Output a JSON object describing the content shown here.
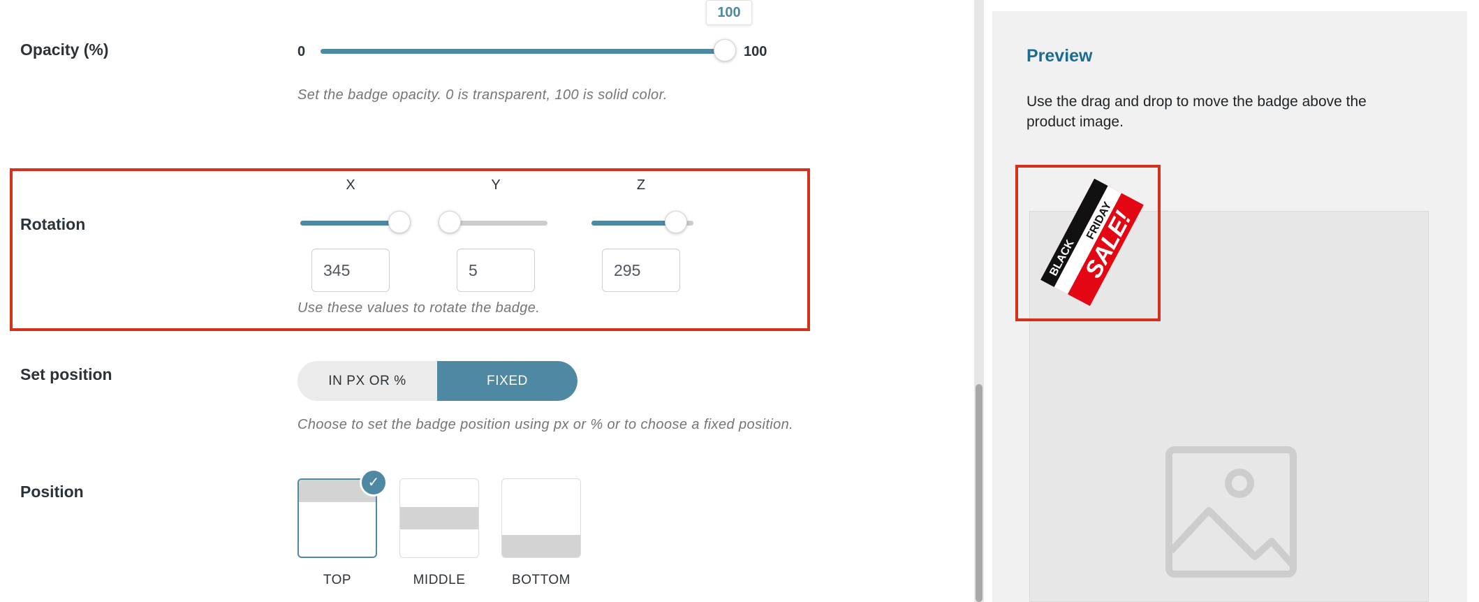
{
  "opacity": {
    "label": "Opacity (%)",
    "min_label": "0",
    "max_label": "100",
    "value": 100,
    "tooltip": "100",
    "description": "Set the badge opacity. 0 is transparent, 100 is solid color."
  },
  "rotation": {
    "label": "Rotation",
    "axes": [
      {
        "name": "X",
        "value": "345"
      },
      {
        "name": "Y",
        "value": "5"
      },
      {
        "name": "Z",
        "value": "295"
      }
    ],
    "description": "Use these values to rotate the badge."
  },
  "set_position": {
    "label": "Set position",
    "options": [
      "IN PX OR %",
      "FIXED"
    ],
    "selected": "FIXED",
    "description": "Choose to set the badge position using px or % or to choose a fixed position."
  },
  "position": {
    "label": "Position",
    "options": [
      "TOP",
      "MIDDLE",
      "BOTTOM"
    ],
    "selected": "TOP"
  },
  "preview": {
    "title": "Preview",
    "text": "Use the drag and drop to move the badge above the product image.",
    "badge_lines": [
      "BLACK",
      "FRIDAY",
      "SALE!"
    ]
  },
  "colors": {
    "accent": "#4f88a3",
    "highlight": "#d4301c",
    "badge_red": "#e30613",
    "badge_black": "#111111"
  },
  "icons": [
    "check-icon",
    "image-placeholder-icon"
  ]
}
